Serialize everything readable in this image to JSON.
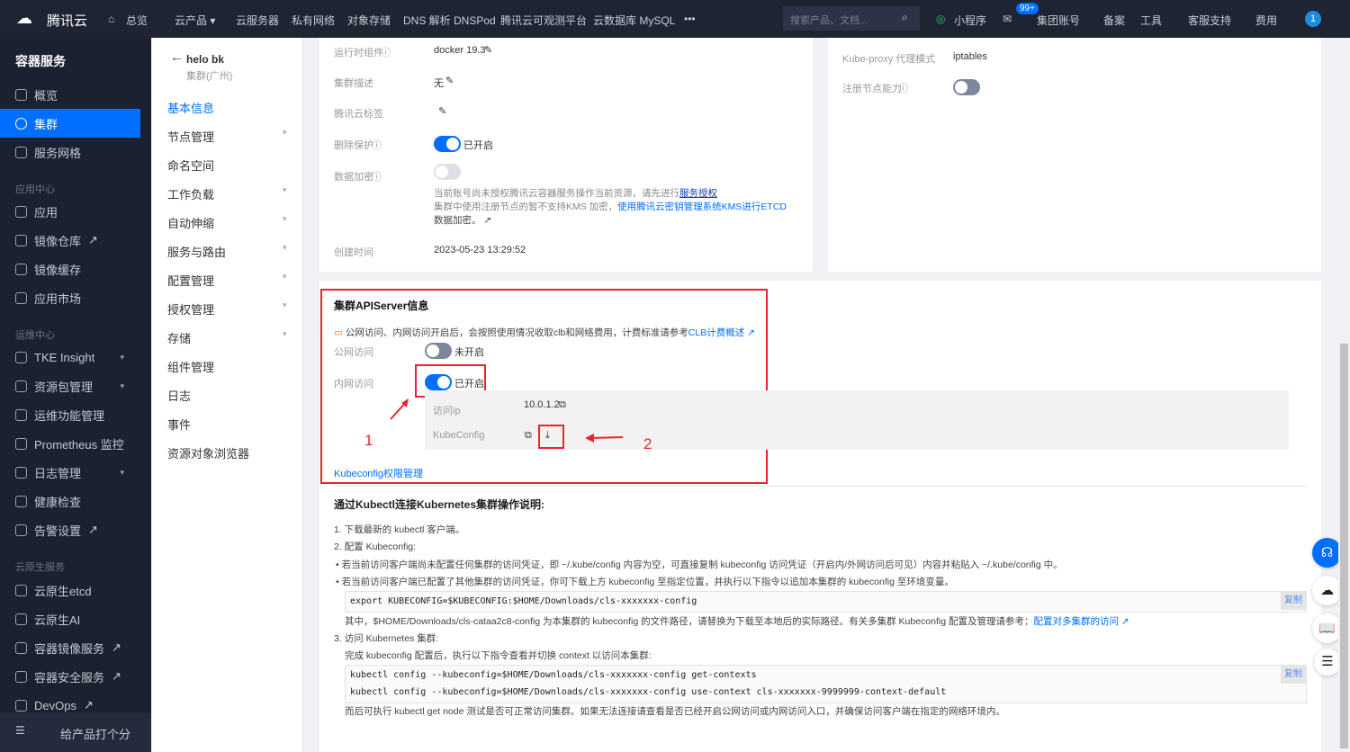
{
  "topbar": {
    "logo": "腾讯云",
    "home": "总览",
    "products": "云产品",
    "links": [
      "云服务器",
      "私有网络",
      "对象存储",
      "DNS 解析 DNSPod",
      "腾讯云可观测平台",
      "云数据库 MySQL"
    ],
    "more": "•••",
    "search_placeholder": "搜索产品、文档...",
    "miniprogram": "小程序",
    "mail_badge": "99+",
    "right": [
      "集团账号",
      "备案",
      "工具",
      "客服支持",
      "费用"
    ],
    "avatar": "1"
  },
  "sidebar": {
    "title": "容器服务",
    "items": [
      {
        "label": "概览"
      },
      {
        "label": "集群"
      },
      {
        "label": "服务网格"
      }
    ],
    "group1": "应用中心",
    "g1": [
      "应用",
      "镜像仓库",
      "镜像缓存",
      "应用市场"
    ],
    "group2": "运维中心",
    "g2": [
      "TKE Insight",
      "资源包管理",
      "运维功能管理",
      "Prometheus 监控",
      "日志管理",
      "健康检查",
      "告警设置"
    ],
    "group3": "云原生服务",
    "g3": [
      "云原生etcd",
      "云原生AI",
      "容器镜像服务",
      "容器安全服务",
      "DevOps"
    ],
    "rate": "给产品打个分"
  },
  "cluster_nav": {
    "name": "helo bk",
    "region": "集群(广州)",
    "items": [
      "基本信息",
      "节点管理",
      "命名空间",
      "工作负载",
      "自动伸缩",
      "服务与路由",
      "配置管理",
      "授权管理",
      "存储",
      "组件管理",
      "日志",
      "事件",
      "资源对象浏览器"
    ]
  },
  "basic": {
    "runtime_label": "运行时组件",
    "runtime": "docker 19.3",
    "desc_label": "集群描述",
    "desc": "无",
    "tag_label": "腾讯云标签",
    "del_label": "删除保护",
    "del_state": "已开启",
    "enc_label": "数据加密",
    "enc_note1": "当前账号尚未授权腾讯云容器服务操作当前资源，请先进行",
    "enc_note1_link": "服务授权",
    "enc_note2": "集群中使用注册节点的暂不支持KMS 加密，",
    "enc_note2_link": "使用腾讯云密钥管理系统KMS进行ETCD",
    "enc_note2_link2": "数据加密。",
    "created_label": "创建时间",
    "created": "2023-05-23 13:29:52",
    "proxy_label": "Kube-proxy 代理模式",
    "proxy": "iptables",
    "reg_label": "注册节点能力"
  },
  "apiserver": {
    "title": "集群APIServer信息",
    "notice": "公网访问、内网访问开启后，会按照使用情况收取clb和网络费用，计费标准请参考",
    "notice_link": "CLB计费概述",
    "public_label": "公网访问",
    "public_state": "未开启",
    "private_label": "内网访问",
    "private_state": "已开启",
    "ip_label": "访问ip",
    "ip": "10.0.1.2",
    "kc_label": "KubeConfig",
    "kc_manage": "Kubeconfig权限管理",
    "ann1": "1",
    "ann2": "2"
  },
  "guide": {
    "title": "通过Kubectl连接Kubernetes集群操作说明:",
    "s1": "1. 下载最新的 kubectl 客户端。",
    "s2": "2. 配置 Kubeconfig:",
    "b1": "若当前访问客户端尚未配置任何集群的访问凭证，即 ~/.kube/config 内容为空，可直接复制 kubeconfig 访问凭证（开启内/外网访问后可见）内容并粘贴入 ~/.kube/config 中。",
    "b2": "若当前访问客户端已配置了其他集群的访问凭证，你可下载上方 kubeconfig 至指定位置，并执行以下指令以追加本集群的 kubeconfig 至环境变量。",
    "code1": "export KUBECONFIG=$KUBECONFIG:$HOME/Downloads/cls-xxxxxxx-config",
    "copy": "复制",
    "note": "其中，$HOME/Downloads/cls-cataa2c8-config 为本集群的 kubeconfig 的文件路径，请替换为下载至本地后的实际路径。有关多集群 Kubeconfig 配置及管理请参考：",
    "note_link": "配置对多集群的访问",
    "s3": "3. 访问 Kubernetes 集群:",
    "s3_desc": "完成 kubeconfig 配置后，执行以下指令查看并切换 context 以访问本集群:",
    "code2a": "kubectl config --kubeconfig=$HOME/Downloads/cls-xxxxxxx-config get-contexts",
    "code2b": "kubectl config --kubeconfig=$HOME/Downloads/cls-xxxxxxx-config use-context cls-xxxxxxx-9999999-context-default",
    "final": "而后可执行 kubectl get node 测试是否可正常访问集群。如果无法连接请查看是否已经开启公网访问或内网访问入口，并确保访问客户端在指定的网络环境内。"
  }
}
